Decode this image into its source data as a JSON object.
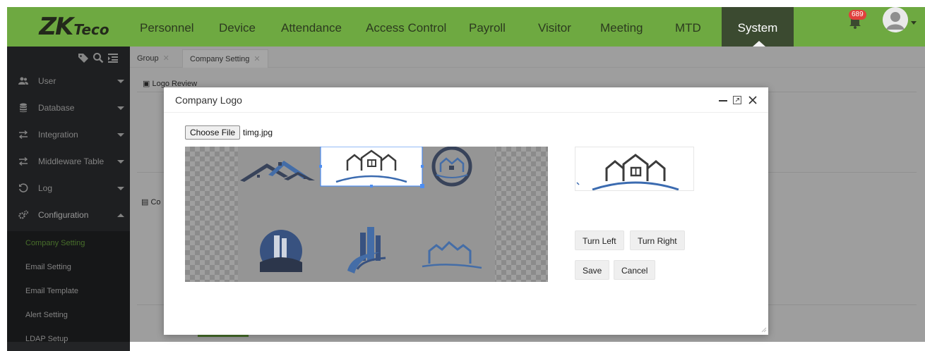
{
  "brand": {
    "name": "ZKTeco",
    "mark": "ZK",
    "suffix": "Teco"
  },
  "nav": {
    "items": [
      "Personnel",
      "Device",
      "Attendance",
      "Access Control",
      "Payroll",
      "Visitor",
      "Meeting",
      "MTD",
      "System"
    ],
    "active": "System"
  },
  "notifications": {
    "count": "689"
  },
  "sidebar": {
    "groups": [
      {
        "label": "User",
        "icon": "users-icon",
        "expanded": false
      },
      {
        "label": "Database",
        "icon": "database-icon",
        "expanded": false
      },
      {
        "label": "Integration",
        "icon": "exchange-icon",
        "expanded": false
      },
      {
        "label": "Middleware Table",
        "icon": "exchange-icon",
        "expanded": false
      },
      {
        "label": "Log",
        "icon": "history-icon",
        "expanded": false
      },
      {
        "label": "Configuration",
        "icon": "cogs-icon",
        "expanded": true
      }
    ],
    "subitems": [
      {
        "label": "Company Setting",
        "active": true
      },
      {
        "label": "Email Setting",
        "active": false
      },
      {
        "label": "Email Template",
        "active": false
      },
      {
        "label": "Alert Setting",
        "active": false
      },
      {
        "label": "LDAP Setup",
        "active": false
      }
    ]
  },
  "tabs": [
    {
      "label": "Group",
      "active": false
    },
    {
      "label": "Company Setting",
      "active": true
    }
  ],
  "page": {
    "logo_review": "Logo Review",
    "section_label": "Co"
  },
  "modal": {
    "title": "Company Logo",
    "choose_file": "Choose File",
    "file_name": "timg.jpg",
    "buttons": {
      "turn_left": "Turn Left",
      "turn_right": "Turn Right",
      "save": "Save",
      "cancel": "Cancel"
    }
  },
  "colors": {
    "accent": "#6ea941",
    "sidebar": "#2f3033",
    "active_nav": "#3b4a30",
    "logo_blue": "#3b6bb0"
  }
}
